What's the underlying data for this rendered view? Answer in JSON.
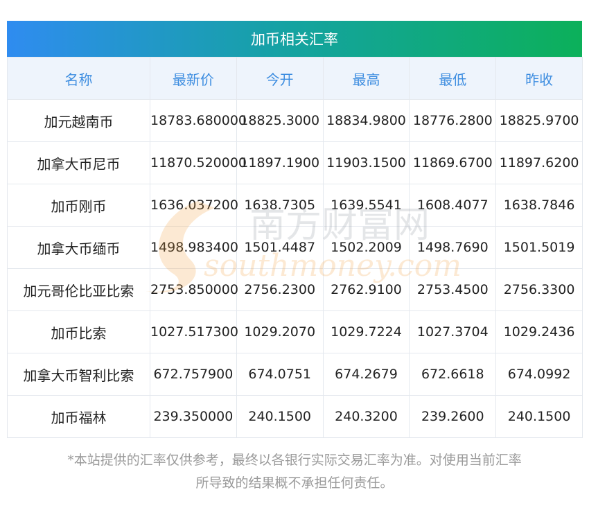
{
  "title": "加币相关汇率",
  "columns": [
    "名称",
    "最新价",
    "今开",
    "最高",
    "最低",
    "昨收"
  ],
  "rows": [
    [
      "加元越南币",
      "18783.680000",
      "18825.3000",
      "18834.9800",
      "18776.2800",
      "18825.9700"
    ],
    [
      "加拿大币尼币",
      "11870.520000",
      "11897.1900",
      "11903.1500",
      "11869.6700",
      "11897.6200"
    ],
    [
      "加币刚币",
      "1636.037200",
      "1638.7305",
      "1639.5541",
      "1608.4077",
      "1638.7846"
    ],
    [
      "加拿大币缅币",
      "1498.983400",
      "1501.4487",
      "1502.2009",
      "1498.7690",
      "1501.5019"
    ],
    [
      "加元哥伦比亚比索",
      "2753.850000",
      "2756.2300",
      "2762.9100",
      "2753.4500",
      "2756.3300"
    ],
    [
      "加币比索",
      "1027.517300",
      "1029.2070",
      "1029.7224",
      "1027.3704",
      "1029.2436"
    ],
    [
      "加拿大币智利比索",
      "672.757900",
      "674.0751",
      "674.2679",
      "672.6618",
      "674.0992"
    ],
    [
      "加币福林",
      "239.350000",
      "240.1500",
      "240.3200",
      "239.2600",
      "240.1500"
    ]
  ],
  "watermark": {
    "cn": "南方财富网",
    "en": "southmoney.com"
  },
  "footnote": {
    "line1": "*本站提供的汇率仅供参考，最终以各银行实际交易汇率为准。对使用当前汇率",
    "line2": "所导致的结果概不承担任何责任。"
  },
  "colors": {
    "header_gradient_start": "#2f8cf0",
    "header_gradient_end": "#0cb05a",
    "column_header_text": "#3d8de0",
    "column_header_bg": "#eef4fc"
  }
}
